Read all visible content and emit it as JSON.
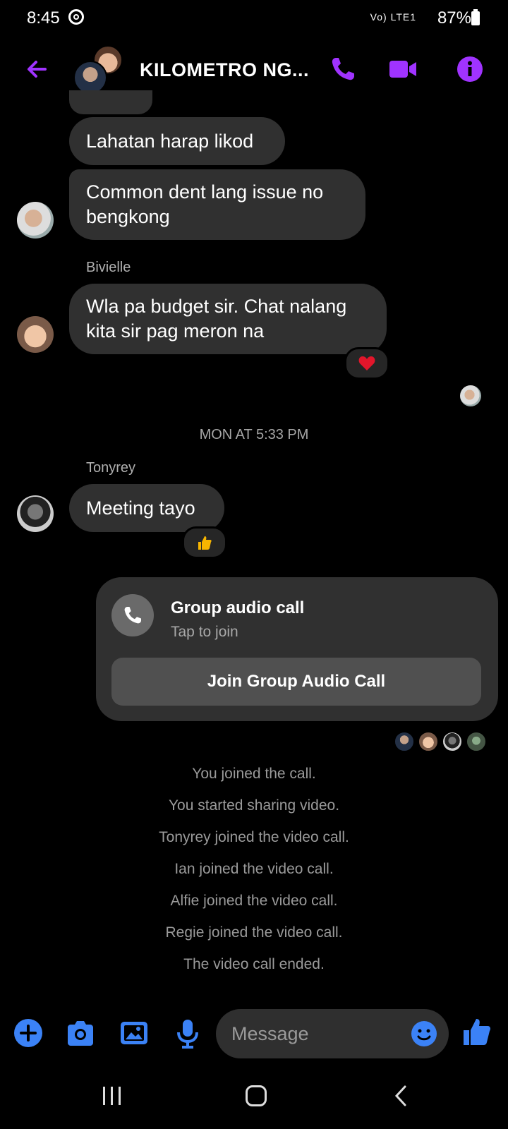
{
  "status_bar": {
    "time": "8:45",
    "battery": "87%",
    "network": "Vo) LTE1"
  },
  "header": {
    "title": "KILOMETRO NG...",
    "accent_color": "#A033FF"
  },
  "messages": [
    {
      "text": "Lahatan harap likod"
    },
    {
      "text": "Common dent lang issue no bengkong"
    },
    {
      "sender": "Bivielle",
      "text": "Wla pa budget sir. Chat nalang kita sir pag meron na",
      "reaction": "heart"
    },
    {
      "sender": "Tonyrey",
      "text": "Meeting tayo",
      "reaction": "thumbs-up"
    }
  ],
  "timestamp": "MON AT 5:33 PM",
  "call_card": {
    "title": "Group audio call",
    "subtitle": "Tap to join",
    "button": "Join Group Audio Call"
  },
  "system_messages": [
    "You joined the call.",
    "You started sharing video.",
    "Tonyrey joined the video call.",
    "Ian joined the video call.",
    "Alfie joined the video call.",
    "Regie joined the video call.",
    "The video call ended."
  ],
  "composer": {
    "placeholder": "Message",
    "icon_color": "#3B82F6"
  }
}
